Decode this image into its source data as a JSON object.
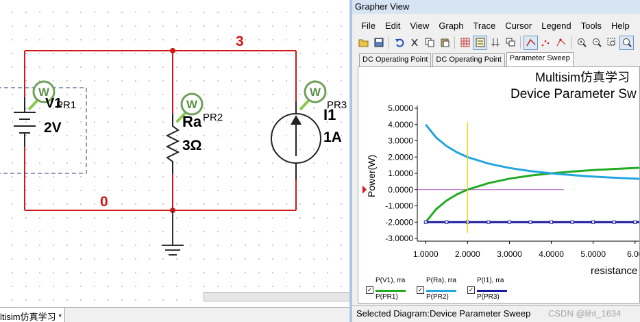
{
  "schematic": {
    "node_labels": {
      "top": "3",
      "bottom": "0"
    },
    "v1": {
      "name": "V1",
      "value": "2V",
      "probe": "PR1"
    },
    "ra": {
      "name": "Ra",
      "value": "3Ω",
      "probe": "PR2"
    },
    "i1": {
      "name": "I1",
      "value": "1A",
      "probe": "PR3"
    },
    "probe_glyph": "W",
    "sheet_tab": "ltisim仿真学习 *"
  },
  "grapher": {
    "window_title": "Grapher View",
    "menu": [
      "File",
      "Edit",
      "View",
      "Graph",
      "Trace",
      "Cursor",
      "Legend",
      "Tools",
      "Help"
    ],
    "toolbar_icons": [
      "open-icon",
      "save-icon",
      "undo-icon",
      "cut-icon",
      "copy-icon",
      "paste-icon",
      "grid-icon",
      "legend-icon",
      "cursor-icon",
      "overlay-icon",
      "line-icon",
      "dots-icon",
      "points-icon",
      "zoom-in-icon",
      "zoom-out-icon",
      "zoom-area-icon",
      "zoom-full-icon"
    ],
    "tabs": [
      {
        "label": "DC Operating Point",
        "active": false
      },
      {
        "label": "DC Operating Point",
        "active": false
      },
      {
        "label": "Parameter Sweep",
        "active": true
      }
    ],
    "status": "Selected Diagram:Device Parameter Sweep",
    "watermark": "CSDN @liht_1634",
    "legend": [
      {
        "line1": "P(V1), rra",
        "line2": "P(PR1)",
        "color": "#22aa22",
        "checked": true
      },
      {
        "line1": "P(Ra), rra",
        "line2": "P(PR2)",
        "color": "#22a6dd",
        "checked": true
      },
      {
        "line1": "P(I1), rra",
        "line2": "P(PR3)",
        "color": "#1a1aa0",
        "checked": true
      }
    ]
  },
  "chart_data": {
    "type": "line",
    "title": "Multisim仿真学习",
    "subtitle": "Device Parameter Sw",
    "xlabel": "resistance",
    "ylabel": "Power(W)",
    "x_ticks": [
      "1.0000",
      "2.0000",
      "3.0000",
      "4.0000",
      "5.0000",
      "6.00"
    ],
    "y_ticks": [
      "5.0000",
      "4.0000",
      "3.0000",
      "2.0000",
      "1.0000",
      "0.0000",
      "-1.0000",
      "-2.0000",
      "-3.0000"
    ],
    "xlim": [
      0.8,
      6.2
    ],
    "ylim": [
      -3.0,
      5.0
    ],
    "grid": false,
    "x": [
      1.0,
      1.25,
      1.5,
      1.75,
      2.0,
      2.5,
      3.0,
      3.5,
      4.0,
      4.5,
      5.0,
      5.5,
      6.0,
      6.2
    ],
    "series": [
      {
        "name": "P(V1), rra",
        "color": "#22aa22",
        "values": [
          -2.0,
          -1.2,
          -0.67,
          -0.29,
          0.0,
          0.4,
          0.67,
          0.86,
          1.0,
          1.11,
          1.2,
          1.27,
          1.33,
          1.35
        ]
      },
      {
        "name": "P(Ra), rra",
        "color": "#22a6dd",
        "values": [
          4.0,
          3.2,
          2.67,
          2.29,
          2.0,
          1.6,
          1.33,
          1.14,
          1.0,
          0.89,
          0.8,
          0.73,
          0.67,
          0.65
        ]
      },
      {
        "name": "P(I1), rra",
        "color": "#1a1aa0",
        "values": [
          -2.0,
          -2.0,
          -2.0,
          -2.0,
          -2.0,
          -2.0,
          -2.0,
          -2.0,
          -2.0,
          -2.0,
          -2.0,
          -2.0,
          -2.0,
          -2.0
        ]
      }
    ],
    "cursor_x": 2.0,
    "cursor_y": 0.0,
    "cursor_color": "#e8d200",
    "hline_color": "#b050c0"
  }
}
